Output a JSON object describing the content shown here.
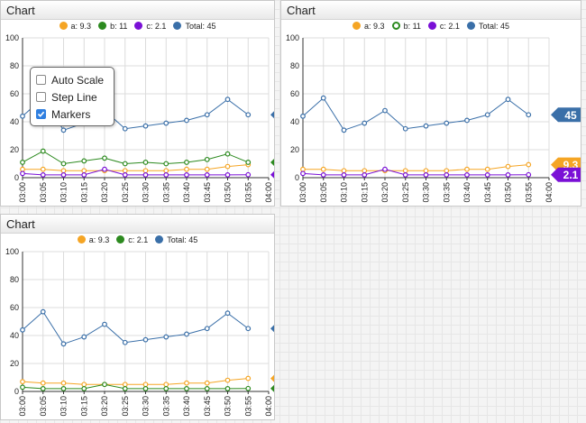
{
  "x_ticks": [
    "03:00",
    "03:05",
    "03:10",
    "03:15",
    "03:20",
    "03:25",
    "03:30",
    "03:35",
    "03:40",
    "03:45",
    "03:50",
    "03:55",
    "04:00"
  ],
  "y_ticks": [
    "0",
    "20",
    "40",
    "60",
    "80",
    "100"
  ],
  "panels": [
    {
      "title": "Chart",
      "legend": [
        {
          "label": "a: 9.3",
          "color": "#f5a524",
          "hollow": false
        },
        {
          "label": "b: 11",
          "color": "#2c8a1f",
          "hollow": false
        },
        {
          "label": "c: 2.1",
          "color": "#7a10d6",
          "hollow": false
        },
        {
          "label": "Total: 45",
          "color": "#3a6fa8",
          "hollow": false
        }
      ],
      "menu": {
        "items": [
          {
            "label": "Auto Scale",
            "checked": false
          },
          {
            "label": "Step Line",
            "checked": false
          },
          {
            "label": "Markers",
            "checked": true
          }
        ]
      }
    },
    {
      "title": "Chart",
      "legend": [
        {
          "label": "a: 9.3",
          "color": "#f5a524",
          "hollow": false
        },
        {
          "label": "b: 11",
          "color": "#2c8a1f",
          "hollow": true
        },
        {
          "label": "c: 2.1",
          "color": "#7a10d6",
          "hollow": false
        },
        {
          "label": "Total: 45",
          "color": "#3a6fa8",
          "hollow": false
        }
      ]
    },
    {
      "title": "Chart",
      "legend": [
        {
          "label": "a: 9.3",
          "color": "#f5a524",
          "hollow": false
        },
        {
          "label": "c: 2.1",
          "color": "#2c8a1f",
          "hollow": false
        },
        {
          "label": "Total: 45",
          "color": "#3a6fa8",
          "hollow": false
        }
      ]
    }
  ],
  "chart_data": [
    {
      "type": "line",
      "title": "Chart",
      "x": [
        "03:00",
        "03:05",
        "03:10",
        "03:15",
        "03:20",
        "03:25",
        "03:30",
        "03:35",
        "03:40",
        "03:45",
        "03:50",
        "03:55"
      ],
      "ylim": [
        0,
        100
      ],
      "grid": true,
      "legend_position": "top",
      "series": [
        {
          "name": "a",
          "color": "#f5a524",
          "values": [
            6,
            6,
            5,
            5,
            5,
            5,
            5,
            5,
            6,
            6,
            8,
            9.3
          ],
          "end_label": "9.3",
          "show_end_label": false
        },
        {
          "name": "b",
          "color": "#2c8a1f",
          "values": [
            11,
            19,
            10,
            12,
            14,
            10,
            11,
            10,
            11,
            13,
            17,
            11
          ],
          "end_label": "11",
          "show_end_label": true
        },
        {
          "name": "c",
          "color": "#7a10d6",
          "values": [
            3,
            2,
            2,
            2,
            6,
            2,
            2,
            2,
            2,
            2,
            2,
            2.1
          ],
          "end_label": "2.1",
          "show_end_label": true
        },
        {
          "name": "Total",
          "color": "#3a6fa8",
          "values": [
            44,
            57,
            34,
            39,
            48,
            35,
            37,
            39,
            41,
            45,
            56,
            45
          ],
          "end_label": "45",
          "show_end_label": true
        }
      ]
    },
    {
      "type": "line",
      "title": "Chart",
      "x": [
        "03:00",
        "03:05",
        "03:10",
        "03:15",
        "03:20",
        "03:25",
        "03:30",
        "03:35",
        "03:40",
        "03:45",
        "03:50",
        "03:55"
      ],
      "ylim": [
        0,
        100
      ],
      "grid": true,
      "legend_position": "top",
      "series": [
        {
          "name": "a",
          "color": "#f5a524",
          "values": [
            6,
            6,
            5,
            5,
            5,
            5,
            5,
            5,
            6,
            6,
            8,
            9.3
          ],
          "end_label": "9.3",
          "show_end_label": true
        },
        {
          "name": "c",
          "color": "#7a10d6",
          "values": [
            3,
            2,
            2,
            2,
            6,
            2,
            2,
            2,
            2,
            2,
            2,
            2.1
          ],
          "end_label": "2.1",
          "show_end_label": true
        },
        {
          "name": "Total",
          "color": "#3a6fa8",
          "values": [
            44,
            57,
            34,
            39,
            48,
            35,
            37,
            39,
            41,
            45,
            56,
            45
          ],
          "end_label": "45",
          "show_end_label": true
        }
      ]
    },
    {
      "type": "line",
      "title": "Chart",
      "x": [
        "03:00",
        "03:05",
        "03:10",
        "03:15",
        "03:20",
        "03:25",
        "03:30",
        "03:35",
        "03:40",
        "03:45",
        "03:50",
        "03:55"
      ],
      "ylim": [
        0,
        100
      ],
      "grid": true,
      "legend_position": "top",
      "series": [
        {
          "name": "a",
          "color": "#f5a524",
          "values": [
            7,
            6,
            6,
            5,
            5,
            5,
            5,
            5,
            6,
            6,
            8,
            9.3
          ],
          "end_label": "9.3",
          "show_end_label": true
        },
        {
          "name": "c",
          "color": "#2c8a1f",
          "values": [
            3,
            2,
            2,
            2,
            5,
            2,
            2,
            2,
            2,
            2,
            2,
            2.1
          ],
          "end_label": "2.1",
          "show_end_label": true
        },
        {
          "name": "Total",
          "color": "#3a6fa8",
          "values": [
            44,
            57,
            34,
            39,
            48,
            35,
            37,
            39,
            41,
            45,
            56,
            45
          ],
          "end_label": "45",
          "show_end_label": true
        }
      ]
    }
  ]
}
